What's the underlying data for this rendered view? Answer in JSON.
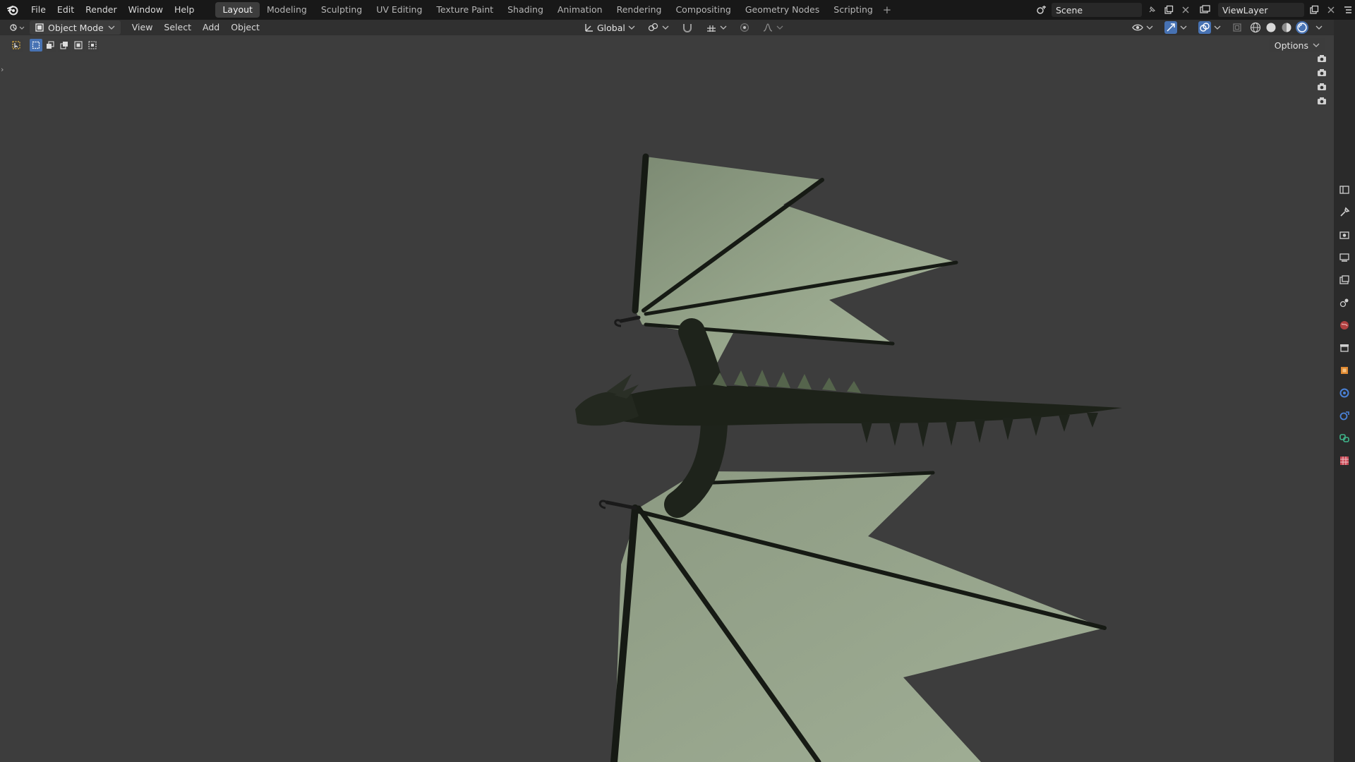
{
  "menubar": {
    "items": [
      "File",
      "Edit",
      "Render",
      "Window",
      "Help"
    ]
  },
  "workspaces": {
    "tabs": [
      "Layout",
      "Modeling",
      "Sculpting",
      "UV Editing",
      "Texture Paint",
      "Shading",
      "Animation",
      "Rendering",
      "Compositing",
      "Geometry Nodes",
      "Scripting"
    ],
    "active": "Layout",
    "add_label": "+"
  },
  "scene": {
    "name": "Scene",
    "view_layer": "ViewLayer"
  },
  "viewport_header": {
    "mode": "Object Mode",
    "menus": [
      "View",
      "Select",
      "Add",
      "Object"
    ],
    "transform_orientation": "Global",
    "options_label": "Options"
  },
  "colors": {
    "accent": "#4772b3",
    "topbar_bg": "#181818",
    "viewport_bg": "#3d3d3d",
    "wing_membrane": "#8f9f84"
  },
  "icons": {
    "logo": "blender-logo-icon",
    "properties_tabs": [
      "tool-icon",
      "render-icon",
      "output-icon",
      "view-layer-icon",
      "scene-icon",
      "world-icon",
      "collection-icon",
      "object-icon",
      "modifier-icon",
      "physics-icon",
      "constraints-icon",
      "data-icon",
      "texture-icon"
    ]
  }
}
